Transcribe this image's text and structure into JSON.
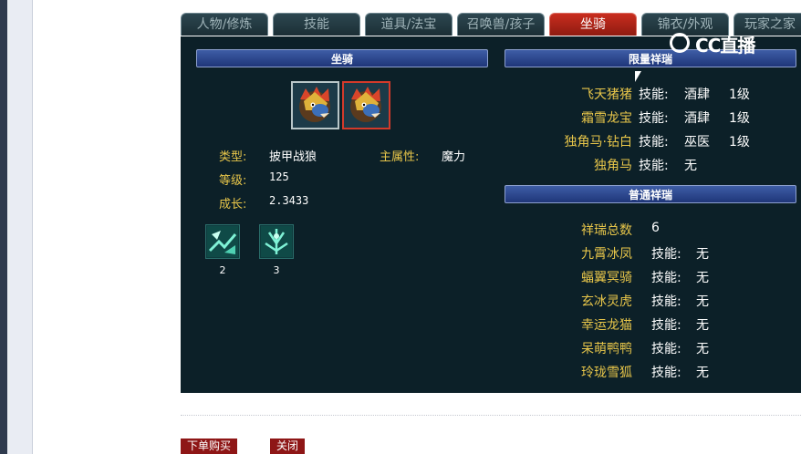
{
  "tabs": [
    {
      "label": "人物/修炼"
    },
    {
      "label": "技能"
    },
    {
      "label": "道具/法宝"
    },
    {
      "label": "召唤兽/孩子"
    },
    {
      "label": "坐骑",
      "active": true
    },
    {
      "label": "锦衣/外观"
    },
    {
      "label": "玩家之家"
    }
  ],
  "mount": {
    "section_title": "坐骑",
    "type_label": "类型:",
    "type_value": "披甲战狼",
    "main_attr_label": "主属性:",
    "main_attr_value": "魔力",
    "level_label": "等级:",
    "level_value": "125",
    "growth_label": "成长:",
    "growth_value": "2.3433",
    "skills": [
      {
        "count": "2"
      },
      {
        "count": "3"
      }
    ]
  },
  "limited": {
    "section_title": "限量祥瑞",
    "items": [
      {
        "name": "飞天猪猪",
        "skill_label": "技能:",
        "skill": "酒肆",
        "level": "1级"
      },
      {
        "name": "霜雪龙宝",
        "skill_label": "技能:",
        "skill": "酒肆",
        "level": "1级"
      },
      {
        "name": "独角马·钻白",
        "skill_label": "技能:",
        "skill": "巫医",
        "level": "1级"
      },
      {
        "name": "独角马",
        "skill_label": "技能:",
        "skill": "无",
        "level": ""
      }
    ]
  },
  "normal": {
    "section_title": "普通祥瑞",
    "total_label": "祥瑞总数",
    "total_value": "6",
    "items": [
      {
        "name": "九霄冰凤",
        "skill_label": "技能:",
        "skill": "无"
      },
      {
        "name": "蝠翼冥骑",
        "skill_label": "技能:",
        "skill": "无"
      },
      {
        "name": "玄冰灵虎",
        "skill_label": "技能:",
        "skill": "无"
      },
      {
        "name": "幸运龙猫",
        "skill_label": "技能:",
        "skill": "无"
      },
      {
        "name": "呆萌鸭鸭",
        "skill_label": "技能:",
        "skill": "无"
      },
      {
        "name": "玲珑雪狐",
        "skill_label": "技能:",
        "skill": "无"
      }
    ]
  },
  "buttons": {
    "buy": "下单购买",
    "close": "关闭"
  },
  "watermark": {
    "text": "CC直播"
  },
  "colors": {
    "label": "#e8c64a",
    "active_tab": "#c92d1e",
    "panel": "#0c2028",
    "button": "#8e1616"
  }
}
